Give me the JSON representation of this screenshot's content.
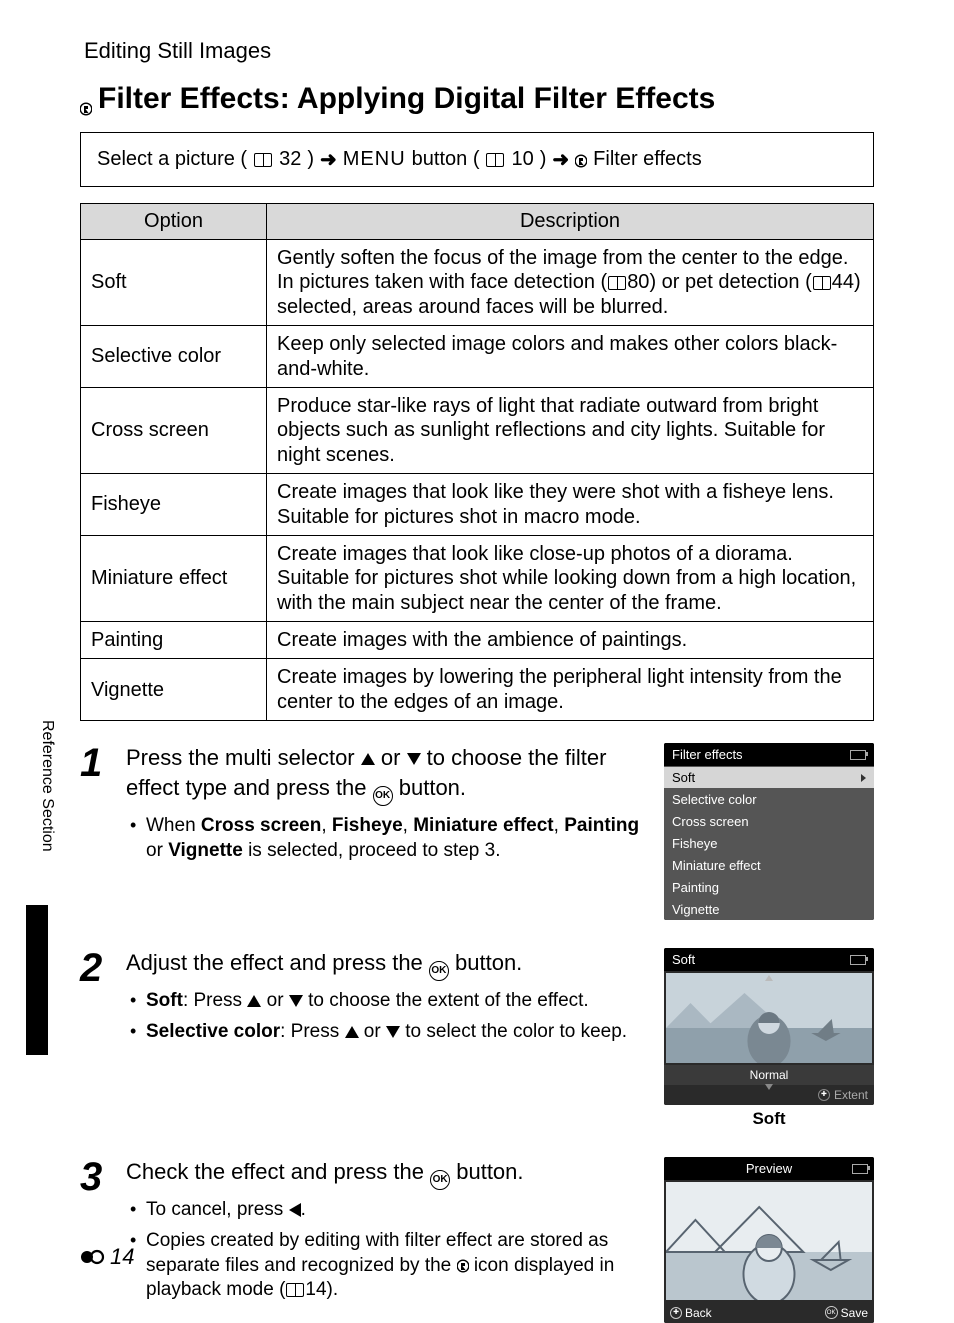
{
  "header": "Editing Still Images",
  "title": "Filter Effects: Applying Digital Filter Effects",
  "breadcrumb": {
    "p1": "Select a picture (",
    "p1_ref": "32",
    "p2": ")",
    "p3_btn": "MENU",
    "p3": " button (",
    "p3_ref": "10",
    "p4": ")",
    "p5": " Filter effects"
  },
  "table": {
    "col1": "Option",
    "col2": "Description",
    "rows": [
      {
        "opt": "Soft",
        "desc_a": "Gently soften the focus of the image from the center to the edge. In pictures taken with face detection (",
        "ref1": "80",
        "desc_b": ") or pet detection (",
        "ref2": "44",
        "desc_c": ") selected, areas around faces will be blurred."
      },
      {
        "opt": "Selective color",
        "desc": "Keep only selected image colors and makes other colors black-and-white."
      },
      {
        "opt": "Cross screen",
        "desc": "Produce star-like rays of light that radiate outward from bright objects such as sunlight reflections and city lights. Suitable for night scenes."
      },
      {
        "opt": "Fisheye",
        "desc": "Create images that look like they were shot with a fisheye lens. Suitable for pictures shot in macro mode."
      },
      {
        "opt": "Miniature effect",
        "desc": "Create images that look like close-up photos of a diorama. Suitable for pictures shot while looking down from a high location, with the main subject near the center of the frame."
      },
      {
        "opt": "Painting",
        "desc": "Create images with the ambience of paintings."
      },
      {
        "opt": "Vignette",
        "desc": "Create images by lowering the peripheral light intensity from the center to the edges of an image."
      }
    ]
  },
  "steps": {
    "s1": {
      "num": "1",
      "lead_a": "Press the multi selector ",
      "lead_b": " or ",
      "lead_c": " to choose the filter effect type and press the ",
      "lead_d": " button.",
      "b1_a": "When ",
      "b1_cs": "Cross screen",
      "b1_b": ", ",
      "b1_fe": "Fisheye",
      "b1_c": ", ",
      "b1_me": "Miniature effect",
      "b1_d": ", ",
      "b1_pa": "Painting",
      "b1_e": " or ",
      "b1_vi": "Vignette",
      "b1_f": " is selected, proceed to step 3."
    },
    "s2": {
      "num": "2",
      "lead_a": "Adjust the effect and press the ",
      "lead_b": " button.",
      "b1_label": "Soft",
      "b1_a": ": Press ",
      "b1_b": " or ",
      "b1_c": " to choose the extent of the effect.",
      "b2_label": "Selective color",
      "b2_a": ": Press ",
      "b2_b": " or ",
      "b2_c": " to select the color to keep."
    },
    "s3": {
      "num": "3",
      "lead_a": "Check the effect and press the ",
      "lead_b": " button.",
      "b1_a": "To cancel, press ",
      "b1_b": ".",
      "b2_a": "Copies created by editing with filter effect are stored as separate files and recognized by the ",
      "b2_b": " icon displayed in playback mode (",
      "b2_ref": "14",
      "b2_c": ")."
    }
  },
  "lcd1": {
    "title": "Filter effects",
    "items": [
      "Soft",
      "Selective color",
      "Cross screen",
      "Fisheye",
      "Miniature effect",
      "Painting",
      "Vignette"
    ]
  },
  "lcd2": {
    "title": "Soft",
    "status": "Normal",
    "hint": "Extent",
    "caption": "Soft"
  },
  "lcd3": {
    "title": "Preview",
    "back": "Back",
    "save": "Save"
  },
  "side": "Reference Section",
  "pagenum": "14"
}
